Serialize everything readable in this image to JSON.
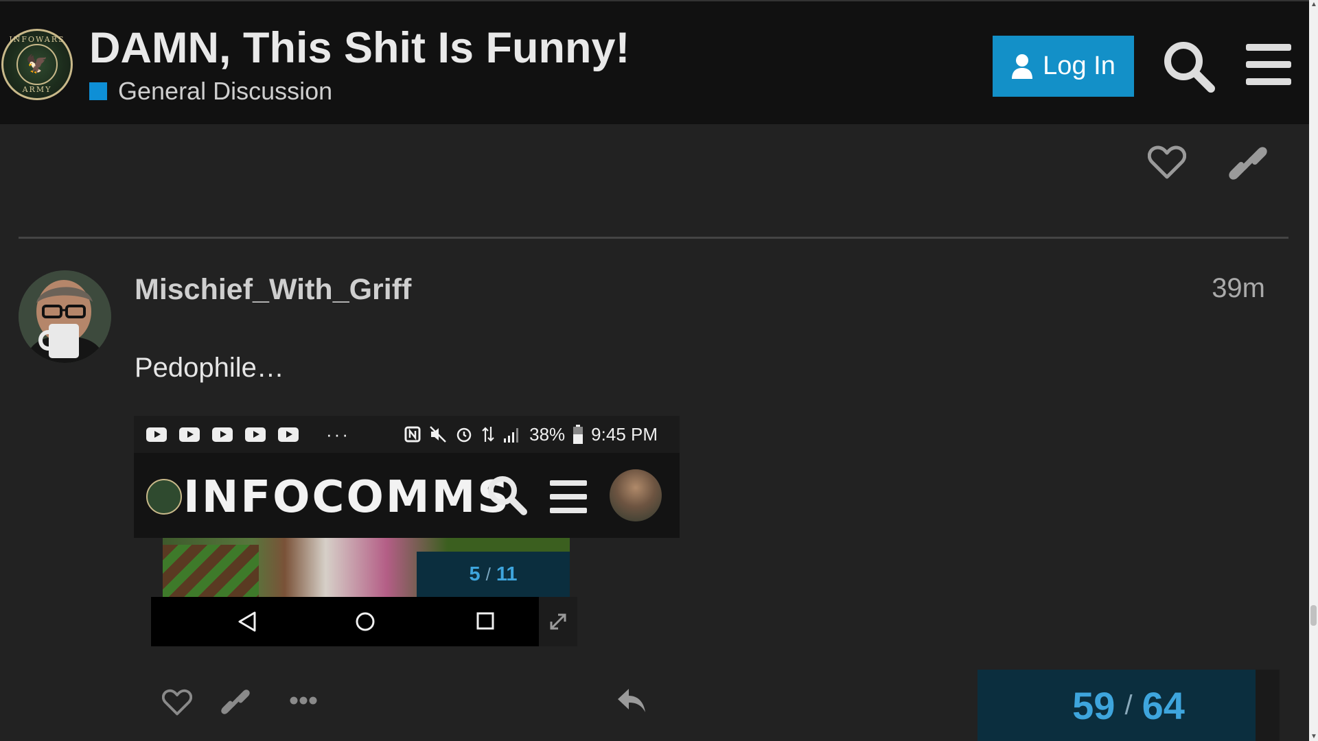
{
  "header": {
    "logo_top_text": "INFOWARS",
    "logo_bottom_text": "ARMY",
    "logo_glyph": "🦅",
    "title": "DAMN, This Shit Is Funny!",
    "category": {
      "label": "General Discussion",
      "color": "#0e8fd6"
    },
    "login_label": "Log In",
    "search_icon": "search-icon",
    "menu_icon": "hamburger-menu-icon",
    "accent_color": "#1390c8"
  },
  "previous_post": {
    "actions": [
      "like-icon",
      "link-icon"
    ]
  },
  "post": {
    "username": "Mischief_With_Griff",
    "time": "39m",
    "body": "Pedophile…",
    "embedded_screenshot": {
      "status_bar": {
        "notification_icons": [
          "youtube-icon",
          "youtube-icon",
          "youtube-icon",
          "youtube-icon",
          "youtube-icon"
        ],
        "more": "···",
        "battery": "38%",
        "clock": "9:45 PM"
      },
      "app_title": "INFOCOMMS",
      "photo_counter": {
        "current": "5",
        "separator": "/",
        "total": "11"
      }
    },
    "actions": [
      "like-icon",
      "link-icon",
      "more-icon",
      "reply-icon"
    ]
  },
  "timeline": {
    "current": "59",
    "separator": "/",
    "total": "64",
    "progress_fraction": 0.92
  }
}
